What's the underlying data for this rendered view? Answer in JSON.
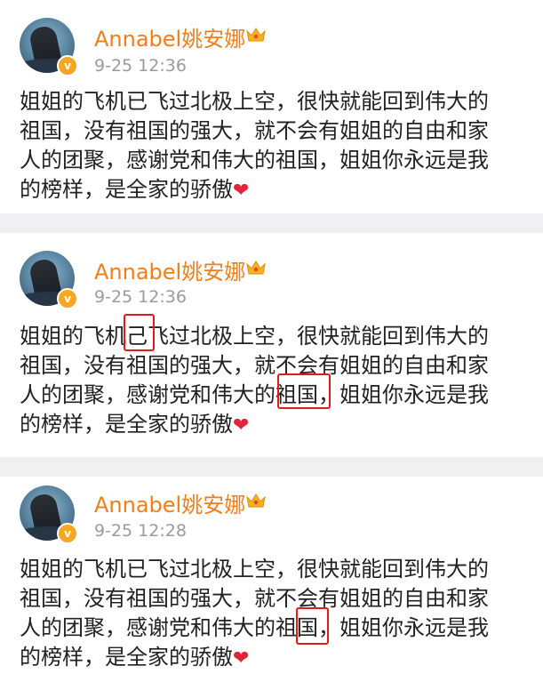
{
  "posts": [
    {
      "username": "Annabel姚安娜",
      "timestamp": "9-25 12:36",
      "verified_badge": "v",
      "lines": [
        "姐姐的飞机已飞过北极上空，很快就能回到伟大的",
        "祖国，没有祖国的强大，就不会有姐姐的自由和家",
        "人的团聚，感谢党和伟大的祖国，姐姐你永远是我",
        "的榜样，是全家的骄傲"
      ],
      "heart": "❤"
    },
    {
      "username": "Annabel姚安娜",
      "timestamp": "9-25 12:36",
      "verified_badge": "v",
      "lines": [
        "姐姐的飞机己飞过北极上空，很快就能回到伟大的",
        "祖国，没有祖国的强大，就不会有姐姐的自由和家",
        "人的团聚，感谢党和伟大的祖国，姐姐你永远是我",
        "的榜样，是全家的骄傲"
      ],
      "heart": "❤"
    },
    {
      "username": "Annabel姚安娜",
      "timestamp": "9-25 12:28",
      "verified_badge": "v",
      "lines": [
        "姐姐的飞机已飞过北极上空，很快就能回到伟大的",
        "祖国，没有祖国的强大，就不会有姐姐的自由和家",
        "人的团聚，感谢党和伟大的祖国，姐姐你永远是我",
        "的榜样，是全家的骄傲"
      ],
      "heart": "❤"
    }
  ],
  "colors": {
    "username": "#ef7f1a",
    "timestamp": "#9b9b9b",
    "text": "#222222",
    "heart": "#e0243a",
    "highlight_box": "#e01b1b",
    "separator": "#f0f0f2",
    "badge": "#f5a623"
  },
  "icons": [
    "avatar",
    "verified-badge-icon",
    "crown-icon",
    "heart-icon"
  ]
}
